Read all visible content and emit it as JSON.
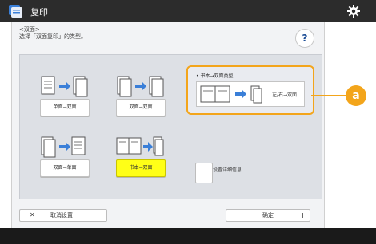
{
  "titlebar": {
    "title": "复印",
    "app_icon": "copy-app-icon",
    "settings_icon": "gear-icon"
  },
  "header": {
    "line1": "<双面>",
    "line2": "选择「双面复印」的类型。",
    "help_label": "?"
  },
  "options": [
    {
      "label": "单面→双面",
      "icon": "one-sided-to-two-sided-icon",
      "selected": false
    },
    {
      "label": "双面→双面",
      "icon": "two-sided-to-two-sided-icon",
      "selected": false
    },
    {
      "label": "双面→单面",
      "icon": "two-sided-to-one-sided-icon",
      "selected": false
    },
    {
      "label": "书本→双面",
      "icon": "book-to-two-sided-icon",
      "selected": true
    }
  ],
  "detail": {
    "title": "• 书本→双面类型",
    "value": "左/右→双面"
  },
  "settings": {
    "label": "设置详细信息"
  },
  "footer": {
    "cancel_label": "取消设置",
    "ok_label": "确定"
  },
  "callout": {
    "label": "a",
    "color": "#f3a51b"
  },
  "colors": {
    "selected": "#ffff17",
    "titlebar": "#2c2c2c",
    "accent": "#f3a51b"
  }
}
